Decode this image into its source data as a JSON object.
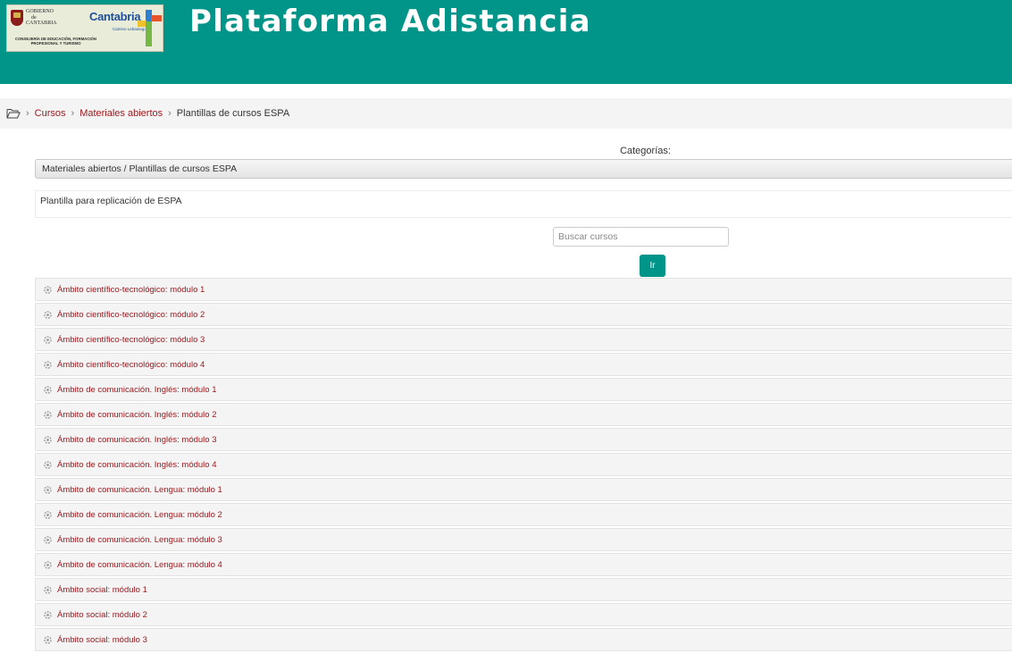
{
  "header": {
    "title": "Plataforma Adistancia",
    "logo_text": {
      "gobierno": "GOBIERNO",
      "de": "de",
      "cantabria_small": "CANTABRIA",
      "consejeria": "CONSEJERÍA DE EDUCACIÓN, FORMACIÓN PROFESIONAL Y TURISMO",
      "cantabria_brand": "Cantabria",
      "camino": "Camino Lebaniego"
    },
    "background_color": "#019489"
  },
  "breadcrumb": {
    "home_icon": "folder-open-icon",
    "items": [
      {
        "label": "Cursos"
      },
      {
        "label": "Materiales abiertos"
      }
    ],
    "current": "Plantillas de cursos ESPA"
  },
  "categories": {
    "label": "Categorías:",
    "selected": "Materiales abiertos / Plantillas de cursos ESPA"
  },
  "description": "Plantilla para replicación de ESPA",
  "search": {
    "placeholder": "Buscar cursos",
    "button_label": "Ir"
  },
  "courses": [
    {
      "name": "Ámbito científico-tecnológico: módulo 1"
    },
    {
      "name": "Ámbito científico-tecnológico: módulo 2"
    },
    {
      "name": "Ámbito científico-tecnológico: módulo 3"
    },
    {
      "name": "Ámbito científico-tecnológico: módulo 4"
    },
    {
      "name": "Ámbito de comunicación. Inglés: módulo 1"
    },
    {
      "name": "Ámbito de comunicación. Inglés: módulo 2"
    },
    {
      "name": "Ámbito de comunicación. Inglés: módulo 3"
    },
    {
      "name": "Ámbito de comunicación. Inglés: módulo 4"
    },
    {
      "name": "Ámbito de comunicación. Lengua: módulo 1"
    },
    {
      "name": "Ámbito de comunicación. Lengua: módulo 2"
    },
    {
      "name": "Ámbito de comunicación. Lengua: módulo 3"
    },
    {
      "name": "Ámbito de comunicación. Lengua: módulo 4"
    },
    {
      "name": "Ámbito social: módulo 1"
    },
    {
      "name": "Ámbito social: módulo 2"
    },
    {
      "name": "Ámbito social: módulo 3"
    }
  ],
  "course_icon": "course-guest-access-icon",
  "colors": {
    "accent": "#019489",
    "link": "#9b1b20"
  }
}
